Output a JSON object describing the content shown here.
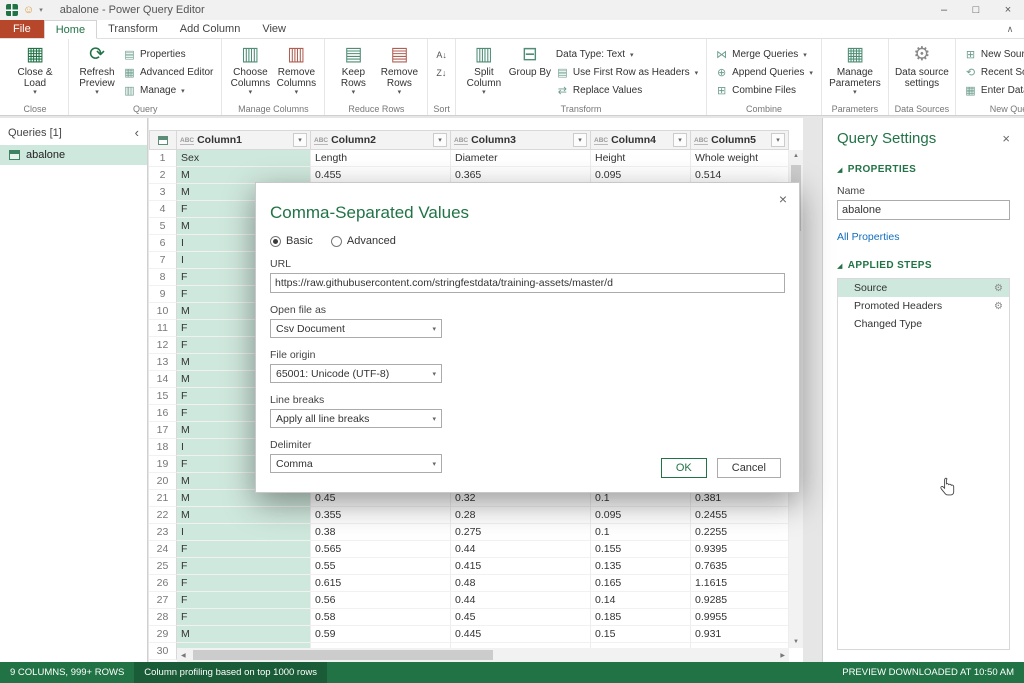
{
  "window": {
    "title": "abalone - Power Query Editor"
  },
  "icons": {
    "caret_down": "▾",
    "chevron_left": "‹",
    "chevron_up": "∧",
    "close": "×",
    "minimize": "–",
    "maximize": "□",
    "gear": "⚙",
    "refresh": "⟳",
    "recent": "⟲",
    "table": "▦",
    "columns": "▥",
    "rows": "▤",
    "grid_plus": "⊞",
    "grid_minus": "⊟",
    "merge": "⋈",
    "append": "⊕",
    "swap": "⇄",
    "sort_az": "A↓",
    "sort_za": "Z↓",
    "smiley": "☺",
    "tri": "◢",
    "up": "▲",
    "down": "▼",
    "left": "◀",
    "right": "▶"
  },
  "tabs": {
    "file": "File",
    "home": "Home",
    "transform": "Transform",
    "add_column": "Add Column",
    "view": "View"
  },
  "ribbon": {
    "labels": {
      "close": "Close",
      "query": "Query",
      "manage_columns": "Manage Columns",
      "reduce_rows": "Reduce Rows",
      "sort": "Sort",
      "transform": "Transform",
      "combine": "Combine",
      "parameters": "Parameters",
      "data_sources": "Data Sources",
      "new_query": "New Query"
    },
    "buttons": {
      "close_load": "Close & Load",
      "refresh_preview": "Refresh Preview",
      "properties": "Properties",
      "advanced_editor": "Advanced Editor",
      "manage": "Manage",
      "choose_columns": "Choose Columns",
      "remove_columns": "Remove Columns",
      "keep_rows": "Keep Rows",
      "remove_rows": "Remove Rows",
      "split_column": "Split Column",
      "group_by": "Group By",
      "data_type": "Data Type: Text",
      "first_row_headers": "Use First Row as Headers",
      "replace_values": "Replace Values",
      "merge_queries": "Merge Queries",
      "append_queries": "Append Queries",
      "combine_files": "Combine Files",
      "manage_parameters": "Manage Parameters",
      "data_source_settings": "Data source settings",
      "new_source": "New Source",
      "recent_sources": "Recent Sources",
      "enter_data": "Enter Data"
    }
  },
  "queries": {
    "header": "Queries [1]",
    "items": [
      {
        "label": "abalone"
      }
    ]
  },
  "grid": {
    "type_badge": "ABC",
    "columns": [
      "Column1",
      "Column2",
      "Column3",
      "Column4",
      "Column5"
    ],
    "rows": [
      {
        "n": "1",
        "c": [
          "Sex",
          "Length",
          "Diameter",
          "Height",
          "Whole weight"
        ]
      },
      {
        "n": "2",
        "c": [
          "M",
          "0.455",
          "0.365",
          "0.095",
          "0.514"
        ]
      },
      {
        "n": "3",
        "c": [
          "M",
          "",
          "",
          "",
          ""
        ]
      },
      {
        "n": "4",
        "c": [
          "F",
          "",
          "",
          "",
          ""
        ]
      },
      {
        "n": "5",
        "c": [
          "M",
          "",
          "",
          "",
          ""
        ]
      },
      {
        "n": "6",
        "c": [
          "I",
          "",
          "",
          "",
          ""
        ]
      },
      {
        "n": "7",
        "c": [
          "I",
          "",
          "",
          "",
          ""
        ]
      },
      {
        "n": "8",
        "c": [
          "F",
          "",
          "",
          "",
          ""
        ]
      },
      {
        "n": "9",
        "c": [
          "F",
          "",
          "",
          "",
          ""
        ]
      },
      {
        "n": "10",
        "c": [
          "M",
          "",
          "",
          "",
          ""
        ]
      },
      {
        "n": "11",
        "c": [
          "F",
          "",
          "",
          "",
          ""
        ]
      },
      {
        "n": "12",
        "c": [
          "F",
          "",
          "",
          "",
          ""
        ]
      },
      {
        "n": "13",
        "c": [
          "M",
          "",
          "",
          "",
          ""
        ]
      },
      {
        "n": "14",
        "c": [
          "M",
          "",
          "",
          "",
          ""
        ]
      },
      {
        "n": "15",
        "c": [
          "F",
          "",
          "",
          "",
          ""
        ]
      },
      {
        "n": "16",
        "c": [
          "F",
          "",
          "",
          "",
          ""
        ]
      },
      {
        "n": "17",
        "c": [
          "M",
          "",
          "",
          "",
          ""
        ]
      },
      {
        "n": "18",
        "c": [
          "I",
          "",
          "",
          "",
          ""
        ]
      },
      {
        "n": "19",
        "c": [
          "F",
          "",
          "",
          "",
          ""
        ]
      },
      {
        "n": "20",
        "c": [
          "M",
          "",
          "",
          "",
          ""
        ]
      },
      {
        "n": "21",
        "c": [
          "M",
          "0.45",
          "0.32",
          "0.1",
          "0.381"
        ]
      },
      {
        "n": "22",
        "c": [
          "M",
          "0.355",
          "0.28",
          "0.095",
          "0.2455"
        ]
      },
      {
        "n": "23",
        "c": [
          "I",
          "0.38",
          "0.275",
          "0.1",
          "0.2255"
        ]
      },
      {
        "n": "24",
        "c": [
          "F",
          "0.565",
          "0.44",
          "0.155",
          "0.9395"
        ]
      },
      {
        "n": "25",
        "c": [
          "F",
          "0.55",
          "0.415",
          "0.135",
          "0.7635"
        ]
      },
      {
        "n": "26",
        "c": [
          "F",
          "0.615",
          "0.48",
          "0.165",
          "1.1615"
        ]
      },
      {
        "n": "27",
        "c": [
          "F",
          "0.56",
          "0.44",
          "0.14",
          "0.9285"
        ]
      },
      {
        "n": "28",
        "c": [
          "F",
          "0.58",
          "0.45",
          "0.185",
          "0.9955"
        ]
      },
      {
        "n": "29",
        "c": [
          "M",
          "0.59",
          "0.445",
          "0.15",
          "0.931"
        ]
      },
      {
        "n": "30",
        "c": [
          "",
          "",
          "",
          "",
          ""
        ]
      }
    ]
  },
  "dialog": {
    "title": "Comma-Separated Values",
    "radio_basic": "Basic",
    "radio_advanced": "Advanced",
    "url_label": "URL",
    "url_value": "https://raw.githubusercontent.com/stringfestdata/training-assets/master/d",
    "open_file_label": "Open file as",
    "open_file_value": "Csv Document",
    "file_origin_label": "File origin",
    "file_origin_value": "65001: Unicode (UTF-8)",
    "line_breaks_label": "Line breaks",
    "line_breaks_value": "Apply all line breaks",
    "delimiter_label": "Delimiter",
    "delimiter_value": "Comma",
    "ok": "OK",
    "cancel": "Cancel"
  },
  "settings": {
    "title": "Query Settings",
    "properties_header": "PROPERTIES",
    "name_label": "Name",
    "name_value": "abalone",
    "all_properties": "All Properties",
    "steps_header": "APPLIED STEPS",
    "steps": [
      {
        "label": "Source"
      },
      {
        "label": "Promoted Headers"
      },
      {
        "label": "Changed Type"
      }
    ]
  },
  "status": {
    "left": "9 COLUMNS, 999+ ROWS",
    "middle": "Column profiling based on top 1000 rows",
    "right": "PREVIEW DOWNLOADED AT 10:50 AM"
  },
  "colors": {
    "accent": "#217346",
    "selection": "#cfe8dd",
    "file_tab": "#b7472a",
    "link": "#106ebe",
    "status_bar": "#217346"
  }
}
